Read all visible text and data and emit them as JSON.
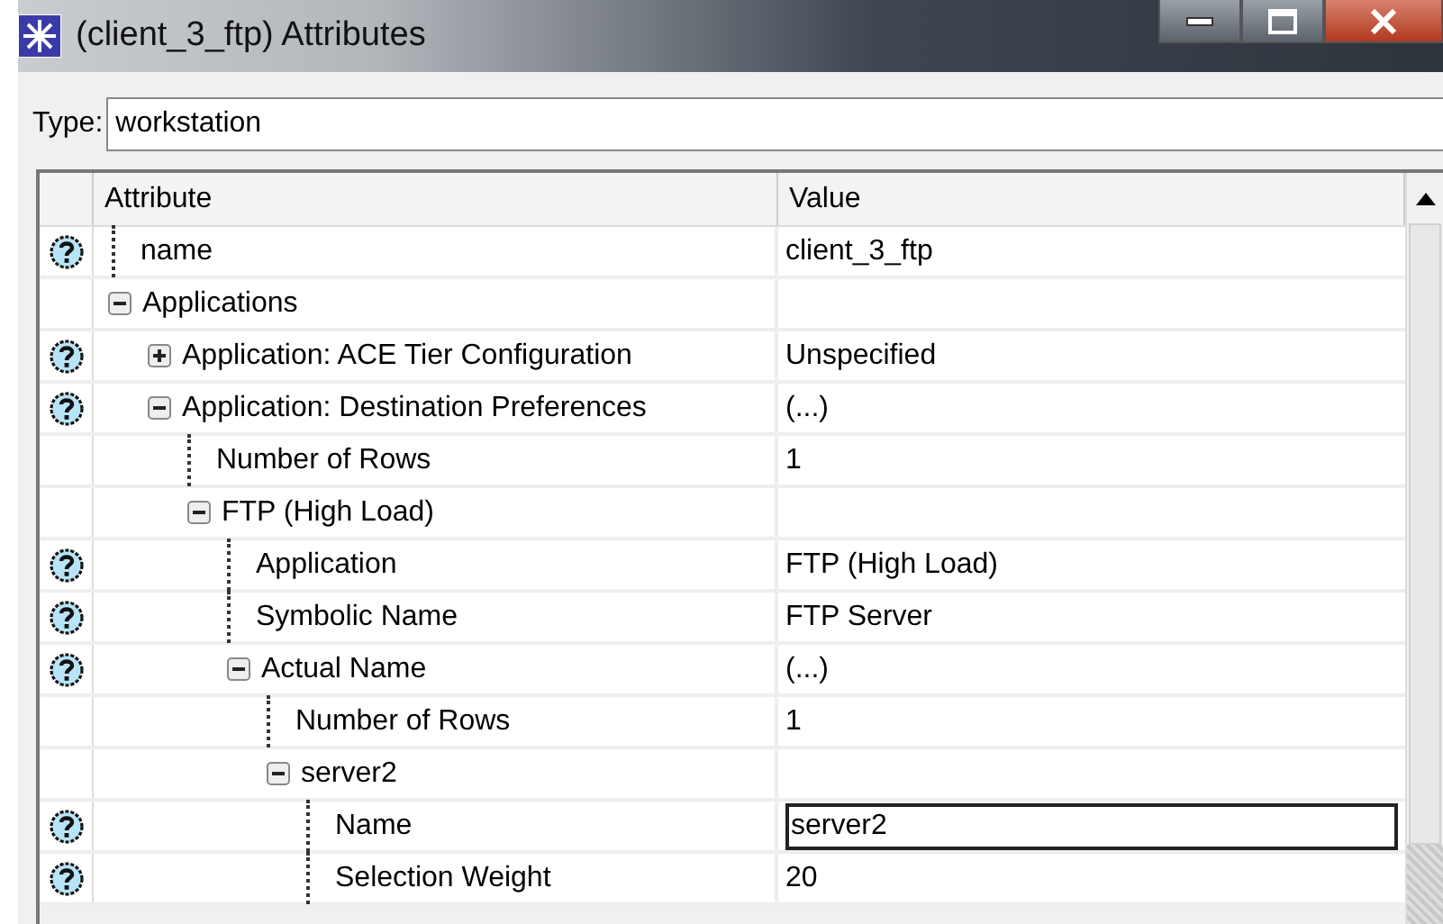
{
  "window": {
    "title": "(client_3_ftp) Attributes"
  },
  "type_field": {
    "label": "Type:",
    "value": "workstation"
  },
  "table": {
    "columns": [
      "Attribute",
      "Value"
    ],
    "rows": [
      {
        "label": "name",
        "value": "client_3_ftp",
        "help": true
      },
      {
        "label": "Applications",
        "help": false,
        "expanded": true,
        "children": [
          {
            "label": "Application: ACE Tier Configuration",
            "value": "Unspecified",
            "help": true,
            "expanded": false
          },
          {
            "label": "Application: Destination Preferences",
            "value": "(...)",
            "help": true,
            "expanded": true,
            "children": [
              {
                "label": "Number of Rows",
                "value": "1",
                "help": false
              },
              {
                "label": "FTP (High Load)",
                "help": false,
                "expanded": true,
                "children": [
                  {
                    "label": "Application",
                    "value": "FTP (High Load)",
                    "help": true
                  },
                  {
                    "label": "Symbolic Name",
                    "value": "FTP Server",
                    "help": true
                  },
                  {
                    "label": "Actual Name",
                    "value": "(...)",
                    "help": true,
                    "expanded": true,
                    "children": [
                      {
                        "label": "Number of Rows",
                        "value": "1",
                        "help": false
                      },
                      {
                        "label": "server2",
                        "help": false,
                        "expanded": true,
                        "children": [
                          {
                            "label": "Name",
                            "value": "server2",
                            "help": true,
                            "editing": true
                          },
                          {
                            "label": "Selection Weight",
                            "value": "20",
                            "help": true
                          }
                        ]
                      }
                    ]
                  }
                ]
              }
            ]
          }
        ]
      }
    ]
  }
}
